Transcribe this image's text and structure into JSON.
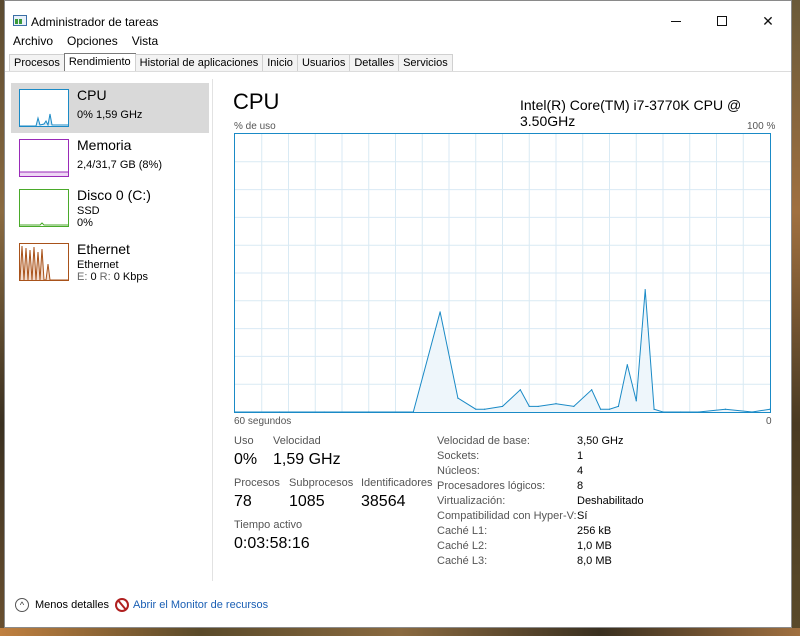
{
  "window": {
    "title": "Administrador de tareas",
    "minimize_glyph": "—",
    "close_glyph": "✕"
  },
  "menu": [
    "Archivo",
    "Opciones",
    "Vista"
  ],
  "tabs": [
    "Procesos",
    "Rendimiento",
    "Historial de aplicaciones",
    "Inicio",
    "Usuarios",
    "Detalles",
    "Servicios"
  ],
  "active_tab": "Rendimiento",
  "sidebar": {
    "items": [
      {
        "name": "CPU",
        "line1": "0% 1,59 GHz",
        "line2": "",
        "color": "#1a8ac6",
        "selected": true
      },
      {
        "name": "Memoria",
        "line1": "2,4/31,7 GB (8%)",
        "line2": "",
        "color": "#9a2ab8"
      },
      {
        "name": "Disco 0 (C:)",
        "line1": "SSD",
        "line2": "0%",
        "color": "#4aaa2a"
      },
      {
        "name": "Ethernet",
        "line1": "Ethernet",
        "line2_label_e": "E:",
        "line2_val_e": "0",
        "line2_label_r": "R:",
        "line2_val_r": "0 Kbps",
        "color": "#a8521a"
      }
    ]
  },
  "cpu": {
    "heading": "CPU",
    "model": "Intel(R) Core(TM) i7-3770K CPU @ 3.50GHz",
    "y_label": "% de uso",
    "y_max_label": "100 %",
    "x_left_label": "60 segundos",
    "x_right_label": "0",
    "usage_label": "Uso",
    "usage_value": "0%",
    "speed_label": "Velocidad",
    "speed_value": "1,59 GHz",
    "processes_label": "Procesos",
    "processes_value": "78",
    "threads_label": "Subprocesos",
    "threads_value": "1085",
    "handles_label": "Identificadores",
    "handles_value": "38564",
    "uptime_label": "Tiempo activo",
    "uptime_value": "0:03:58:16",
    "info": [
      {
        "key": "Velocidad de base:",
        "value": "3,50 GHz"
      },
      {
        "key": "Sockets:",
        "value": "1"
      },
      {
        "key": "Núcleos:",
        "value": "4"
      },
      {
        "key": "Procesadores lógicos:",
        "value": "8"
      },
      {
        "key": "Virtualización:",
        "value": "Deshabilitado"
      },
      {
        "key": "Compatibilidad con Hyper-V:",
        "value": "Sí"
      },
      {
        "key": "Caché L1:",
        "value": "256 kB"
      },
      {
        "key": "Caché L2:",
        "value": "1,0 MB"
      },
      {
        "key": "Caché L3:",
        "value": "8,0 MB"
      }
    ]
  },
  "footer": {
    "less_details": "Menos detalles",
    "resource_monitor": "Abrir el Monitor de recursos"
  },
  "chart_data": {
    "type": "area",
    "x": [
      60,
      55,
      50,
      45,
      40,
      37,
      35,
      33,
      32,
      30,
      28,
      27,
      26,
      24,
      22,
      20,
      19,
      18,
      17,
      16,
      15,
      14,
      13,
      12,
      10,
      8,
      5,
      2,
      0
    ],
    "values": [
      0,
      0,
      0,
      0,
      0,
      36,
      5,
      1,
      1,
      2,
      8,
      2,
      2,
      3,
      2,
      8,
      1,
      1,
      2,
      17,
      4,
      44,
      1,
      0,
      0,
      0,
      1,
      0,
      1
    ],
    "xlabel": "60 segundos",
    "ylabel": "% de uso",
    "ylim": [
      0,
      100
    ],
    "xlim": [
      60,
      0
    ],
    "grid": true,
    "color": "#1a8ac6"
  }
}
